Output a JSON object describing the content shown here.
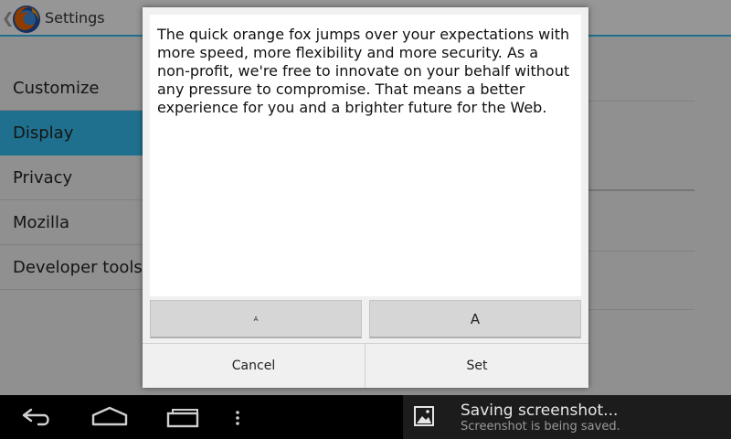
{
  "actionbar": {
    "title": "Settings",
    "icon": "firefox-logo"
  },
  "sidebar": {
    "items": [
      {
        "label": "Customize",
        "active": false
      },
      {
        "label": "Display",
        "active": true
      },
      {
        "label": "Privacy",
        "active": false
      },
      {
        "label": "Mozilla",
        "active": false
      },
      {
        "label": "Developer tools",
        "active": false
      }
    ]
  },
  "dialog": {
    "preview_text": "The quick orange fox jumps over your expectations with more speed, more flexibility and more security. As a non-profit, we're free to innovate on your behalf without any pressure to compromise. That means a better experience for you and a brighter future for the Web.",
    "smaller_label": "A",
    "larger_label": "A",
    "cancel_label": "Cancel",
    "set_label": "Set"
  },
  "notification": {
    "title": "Saving screenshot...",
    "subtitle": "Screenshot is being saved.",
    "icon": "image-icon"
  },
  "navbar": {
    "icons": [
      "back-icon",
      "home-icon",
      "recent-apps-icon",
      "menu-icon"
    ]
  },
  "colors": {
    "accent": "#33b5e5"
  }
}
